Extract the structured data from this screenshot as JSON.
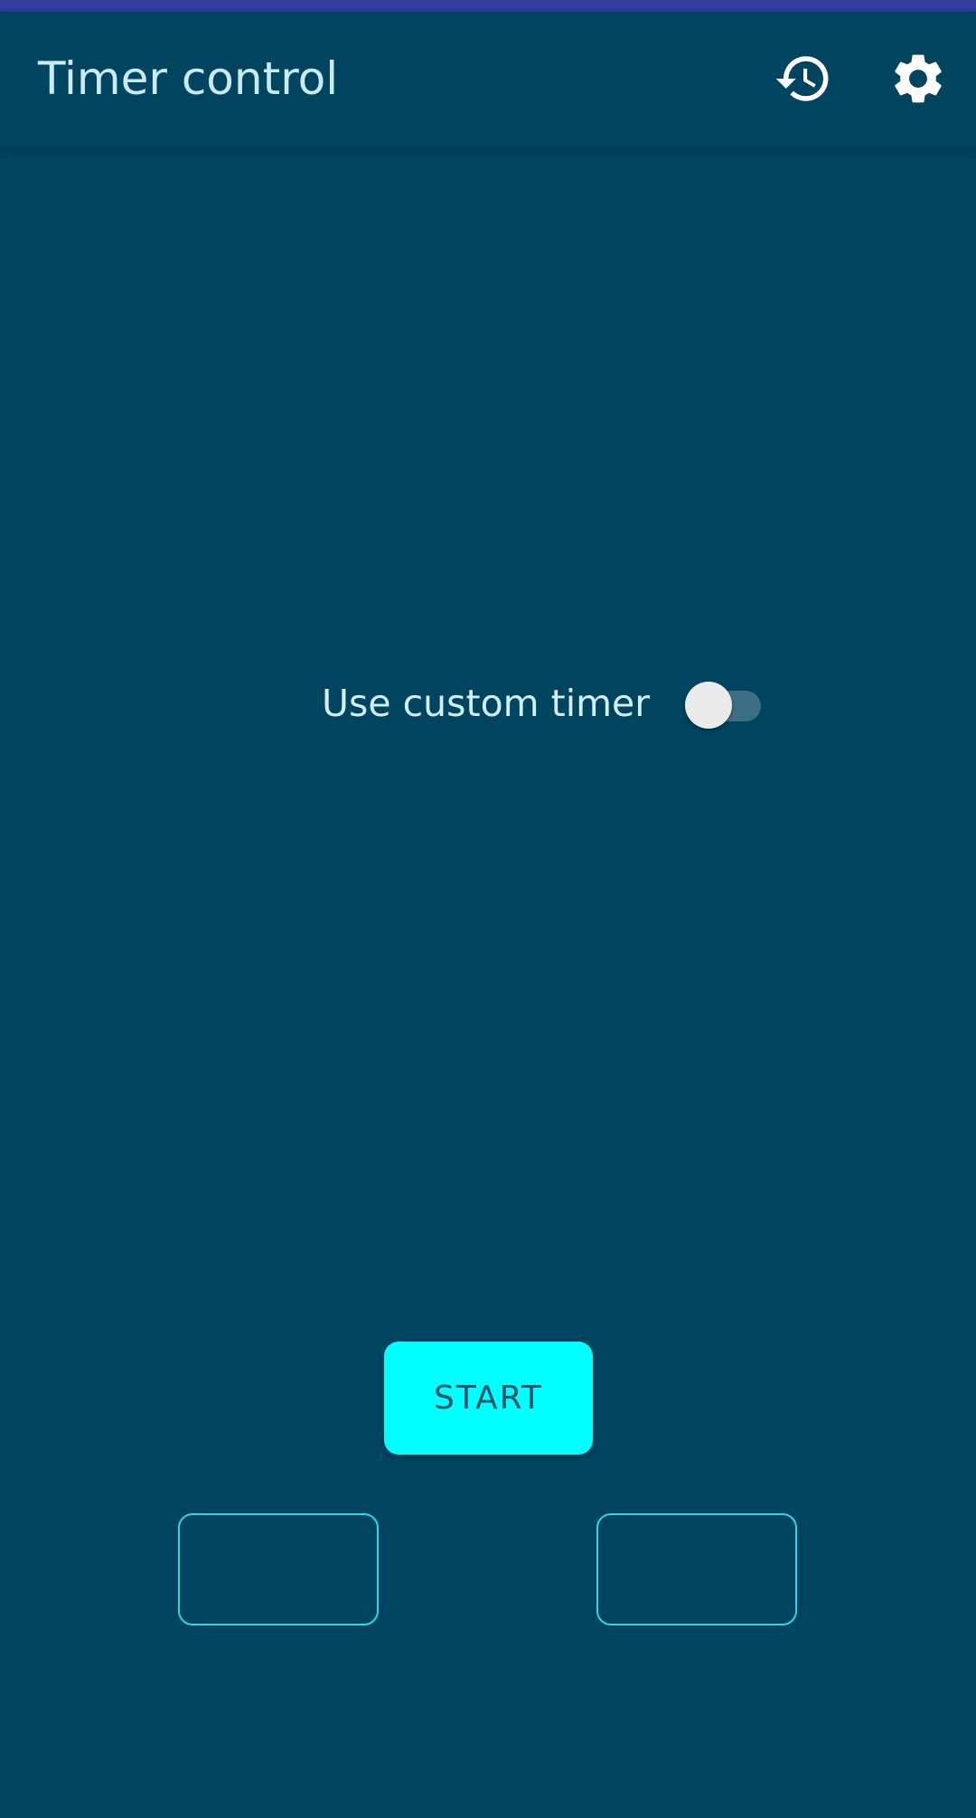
{
  "app_bar": {
    "title": "Timer control",
    "actions": [
      {
        "icon": "history-icon"
      },
      {
        "icon": "gear-icon"
      }
    ]
  },
  "custom_timer": {
    "label": "Use custom timer",
    "enabled": false
  },
  "controls": {
    "start_label": "START",
    "left_button_label": "",
    "right_button_label": ""
  },
  "colors": {
    "background": "#01445f",
    "status_bar": "#2f3d9c",
    "accent": "#00ffff",
    "outline": "#2fd6e6"
  }
}
